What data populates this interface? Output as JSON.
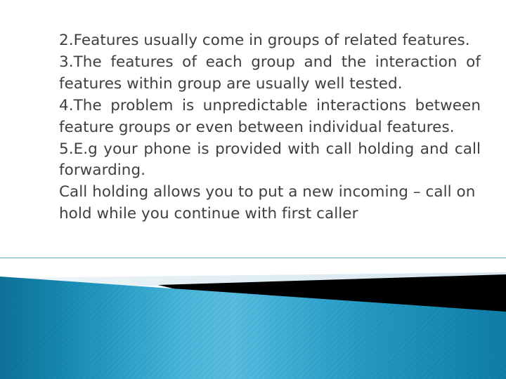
{
  "slide": {
    "type": "presentation-slide",
    "background_color": "#ffffff",
    "text_color": "#3f3f3f",
    "body": [
      {
        "id": "item-2",
        "text": "2.Features usually come in groups of related features.",
        "align": "justify"
      },
      {
        "id": "item-3",
        "text": "3.The features of each group and the interaction of features within group are usually well tested.",
        "align": "justify"
      },
      {
        "id": "item-4",
        "text": "4.The problem is unpredictable interactions between feature groups or even between individual features.",
        "align": "justify"
      },
      {
        "id": "item-5",
        "text": "5.E.g your phone is provided with call holding and call forwarding.",
        "align": "justify"
      },
      {
        "id": "item-6",
        "text": "Call holding allows you to put a new incoming – call on hold while you continue with first caller",
        "align": "justify"
      }
    ]
  },
  "decoration": {
    "rule_color": "#5fa8bd",
    "pale_band_color": "#d9e8ef",
    "black_wedge_color": "#000000",
    "blue_gradient": {
      "left": "#11769b",
      "mid_left": "#1d93bd",
      "mid": "#46b4dc",
      "mid_right": "#2fa3cf",
      "right": "#1287b0"
    }
  }
}
